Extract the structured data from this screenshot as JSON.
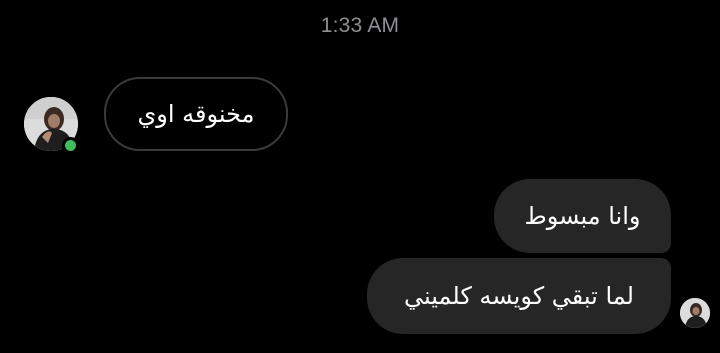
{
  "header": {
    "timestamp": "1:33 AM"
  },
  "conversation": {
    "messages": [
      {
        "direction": "incoming",
        "text": "مخنوقه اوي"
      },
      {
        "direction": "outgoing",
        "text": "وانا مبسوط"
      },
      {
        "direction": "outgoing",
        "text": "لما تبقي كويسه كلميني"
      }
    ]
  },
  "contact": {
    "avatar_icon": "profile-photo-icon",
    "status": "online"
  },
  "colors": {
    "background": "#000000",
    "timestamp": "#8e8e93",
    "incoming_border": "#3a3a3c",
    "outgoing_bubble": "#262626",
    "online": "#3fbe5c"
  }
}
